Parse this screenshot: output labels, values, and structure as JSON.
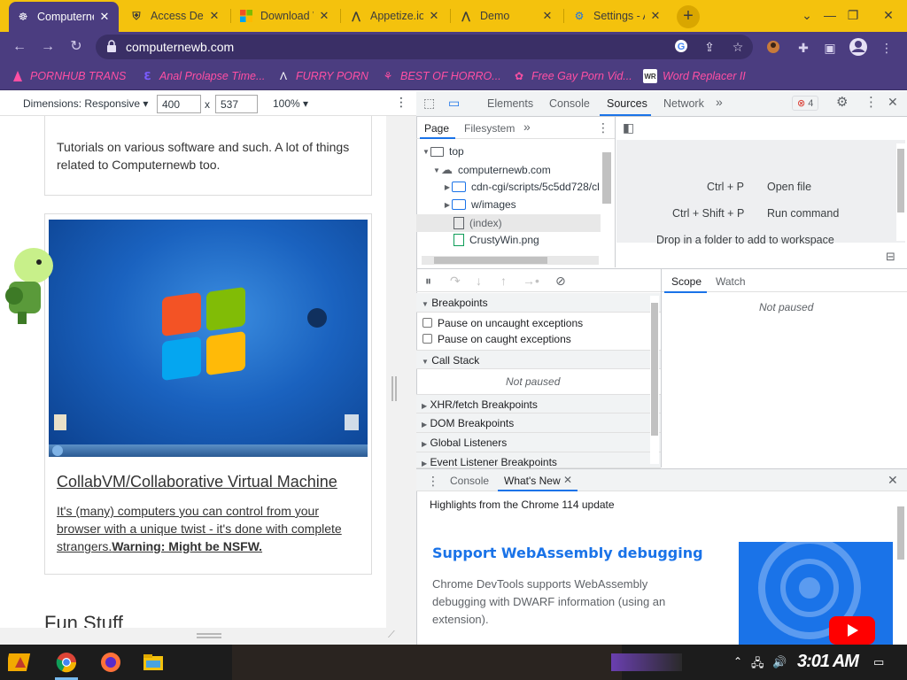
{
  "browser": {
    "tabs": [
      {
        "title": "Computernewb",
        "icon": "computernewb-icon",
        "active": true
      },
      {
        "title": "Access Denied",
        "icon": "shield-icon",
        "active": false
      },
      {
        "title": "Download Windows",
        "icon": "microsoft-icon",
        "active": false
      },
      {
        "title": "Appetize.io",
        "icon": "appetize-icon",
        "active": false
      },
      {
        "title": "Demo",
        "icon": "appetize-icon",
        "active": false
      },
      {
        "title": "Settings - Appearance",
        "icon": "gear-icon",
        "active": false
      }
    ],
    "url": "computernewb.com",
    "bookmarks": [
      {
        "label": "PORNHUB TRANS"
      },
      {
        "label": "Anal Prolapse Time..."
      },
      {
        "label": "FURRY PORN"
      },
      {
        "label": "BEST OF HORRO..."
      },
      {
        "label": "Free Gay Porn Vid..."
      },
      {
        "label": "Word Replacer II",
        "icon_text": "WR"
      }
    ],
    "colors": {
      "tabstrip": "#f4c20d",
      "toolbar": "#4b3d80",
      "bookmark_text": "#ff4fa3"
    }
  },
  "device_toolbar": {
    "dimensions_label": "Dimensions: Responsive",
    "width": "400",
    "height": "537",
    "times": "x",
    "zoom": "100%"
  },
  "page": {
    "card1_text": "Tutorials on various software and such. A lot of things related to Computernewb too.",
    "card2_title": "CollabVM/Collaborative Virtual Machine",
    "card2_desc": "It's (many) computers you can control from your browser with a unique twist - it's done with complete strangers.",
    "card2_warning": "Warning: Might be NSFW.",
    "fun_heading": "Fun Stuff"
  },
  "devtools": {
    "top_tabs": [
      "Elements",
      "Console",
      "Sources",
      "Network"
    ],
    "selected_tab": "Sources",
    "error_count": "4",
    "navigator_tabs": [
      "Page",
      "Filesystem"
    ],
    "tree": [
      {
        "label": "top",
        "kind": "frame"
      },
      {
        "label": "computernewb.com",
        "kind": "cloud"
      },
      {
        "label": "cdn-cgi/scripts/5c5dd728/cl",
        "kind": "folder"
      },
      {
        "label": "w/images",
        "kind": "folder"
      },
      {
        "label": "(index)",
        "kind": "file"
      },
      {
        "label": "CrustyWin.png",
        "kind": "image"
      }
    ],
    "shortcuts": [
      {
        "keys": "Ctrl + P",
        "action": "Open file"
      },
      {
        "keys": "Ctrl + Shift + P",
        "action": "Run command"
      }
    ],
    "drop_hint": "Drop in a folder to add to workspace",
    "scope_tab": "Scope",
    "watch_tab": "Watch",
    "not_paused": "Not paused",
    "sections": {
      "breakpoints": "Breakpoints",
      "pause_uncaught": "Pause on uncaught exceptions",
      "pause_caught": "Pause on caught exceptions",
      "call_stack": "Call Stack",
      "call_stack_status": "Not paused",
      "xhr": "XHR/fetch Breakpoints",
      "dom": "DOM Breakpoints",
      "global": "Global Listeners",
      "event": "Event Listener Breakpoints"
    },
    "drawer": {
      "tabs": [
        "Console",
        "What's New"
      ],
      "highlight": "Highlights from the Chrome 114 update",
      "headline": "Support WebAssembly debugging",
      "body": "Chrome DevTools supports WebAssembly debugging with DWARF information (using an extension)."
    }
  },
  "taskbar": {
    "clock": "3:01 AM"
  }
}
